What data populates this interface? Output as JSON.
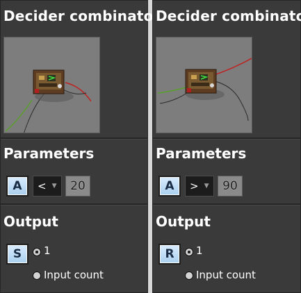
{
  "panels": [
    {
      "title": "Decider combinator",
      "parameters_label": "Parameters",
      "first_signal": "A",
      "comparator": "<",
      "constant": "20",
      "output_label": "Output",
      "output_signal": "S",
      "output_one_label": "1",
      "input_count_label": "Input count"
    },
    {
      "title": "Decider combinator",
      "parameters_label": "Parameters",
      "first_signal": "A",
      "comparator": ">",
      "constant": "90",
      "output_label": "Output",
      "output_signal": "R",
      "output_one_label": "1",
      "input_count_label": "Input count"
    }
  ]
}
